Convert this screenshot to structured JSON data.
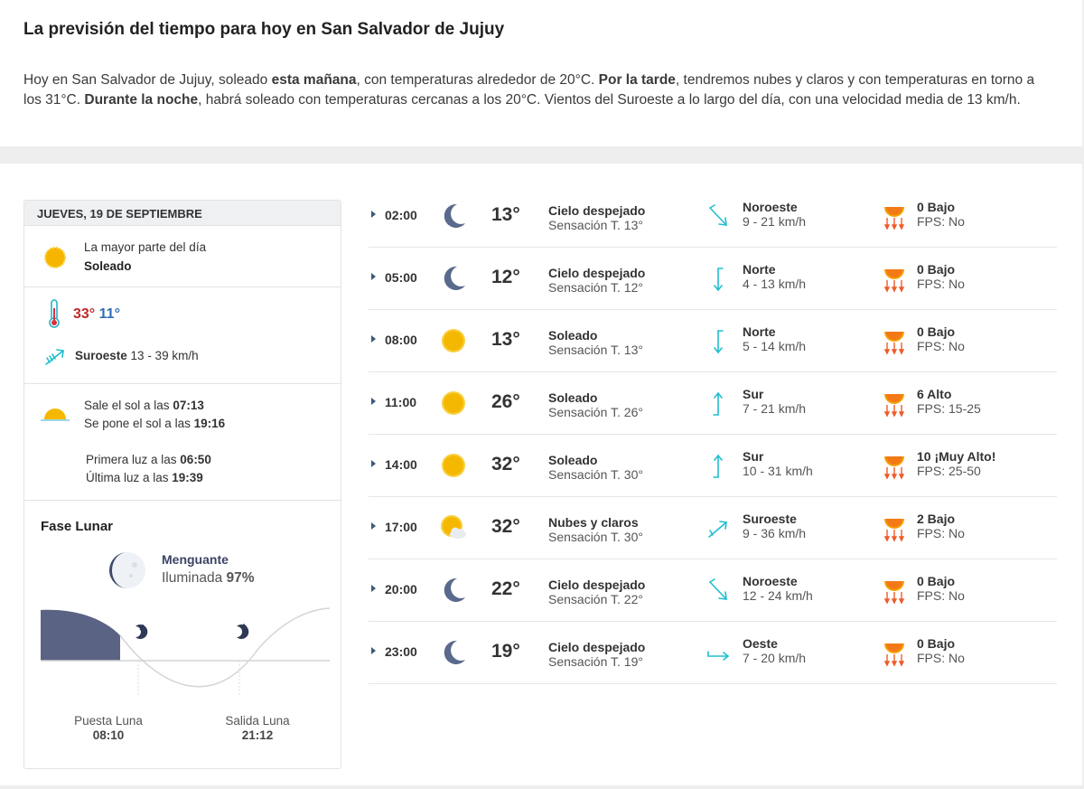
{
  "intro": {
    "title": "La previsión del tiempo para hoy en San Salvador de Jujuy",
    "p1": "Hoy en San Salvador de Jujuy, soleado ",
    "b1": "esta mañana",
    "p2": ", con temperaturas alrededor de 20°C. ",
    "b2": "Por la tarde",
    "p3": ", tendremos nubes y claros y con temperaturas en torno a los 31°C. ",
    "b3": "Durante la noche",
    "p4": ", habrá soleado con temperaturas cercanas a los 20°C. Vientos del Suroeste a lo largo del día, con una velocidad media de 13 km/h."
  },
  "day": {
    "header": "JUEVES, 19 DE SEPTIEMBRE",
    "summary_label": "La mayor parte del día",
    "summary_value": "Soleado",
    "tmax": "33°",
    "tmin": "11°",
    "wind_dir": "Suroeste",
    "wind_speed": "13 - 39 km/h",
    "sunrise_label": "Sale el sol a las ",
    "sunrise": "07:13",
    "sunset_label": "Se pone el sol a las ",
    "sunset": "19:16",
    "firstlight_label": "Primera luz a las ",
    "firstlight": "06:50",
    "lastlight_label": "Última luz a las ",
    "lastlight": "19:39",
    "moon_title": "Fase Lunar",
    "moon_phase": "Menguante",
    "moon_illum_label": "Iluminada ",
    "moon_illum": "97%",
    "moonset_label": "Puesta Luna",
    "moonset": "08:10",
    "moonrise_label": "Salida Luna",
    "moonrise": "21:12"
  },
  "colors": {
    "max_temp": "#c0282b",
    "min_temp": "#2f6fb5",
    "wind_icon": "#1fbfcf",
    "sun": "#f5b800",
    "moon": "#5a6a8c",
    "moon_chart": "#5a6383"
  },
  "hours": [
    {
      "time": "02:00",
      "icon": "moon-icon",
      "temp": "13°",
      "desc": "Cielo despejado",
      "feel": "Sensación T. 13°",
      "wind_dir": "Noroeste",
      "wind_speed": "9 - 21 km/h",
      "uv": "0 Bajo",
      "fps": "FPS: No"
    },
    {
      "time": "05:00",
      "icon": "moon-icon",
      "temp": "12°",
      "desc": "Cielo despejado",
      "feel": "Sensación T. 12°",
      "wind_dir": "Norte",
      "wind_speed": "4 - 13 km/h",
      "uv": "0 Bajo",
      "fps": "FPS: No"
    },
    {
      "time": "08:00",
      "icon": "sun-icon",
      "temp": "13°",
      "desc": "Soleado",
      "feel": "Sensación T. 13°",
      "wind_dir": "Norte",
      "wind_speed": "5 - 14 km/h",
      "uv": "0 Bajo",
      "fps": "FPS: No"
    },
    {
      "time": "11:00",
      "icon": "sun-icon",
      "temp": "26°",
      "desc": "Soleado",
      "feel": "Sensación T. 26°",
      "wind_dir": "Sur",
      "wind_speed": "7 - 21 km/h",
      "uv": "6 Alto",
      "fps": "FPS: 15-25"
    },
    {
      "time": "14:00",
      "icon": "sun-icon",
      "temp": "32°",
      "desc": "Soleado",
      "feel": "Sensación T. 30°",
      "wind_dir": "Sur",
      "wind_speed": "10 - 31 km/h",
      "uv": "10 ¡Muy Alto!",
      "fps": "FPS: 25-50"
    },
    {
      "time": "17:00",
      "icon": "partly-cloudy-icon",
      "temp": "32°",
      "desc": "Nubes y claros",
      "feel": "Sensación T. 30°",
      "wind_dir": "Suroeste",
      "wind_speed": "9 - 36 km/h",
      "uv": "2 Bajo",
      "fps": "FPS: No"
    },
    {
      "time": "20:00",
      "icon": "moon-icon",
      "temp": "22°",
      "desc": "Cielo despejado",
      "feel": "Sensación T. 22°",
      "wind_dir": "Noroeste",
      "wind_speed": "12 - 24 km/h",
      "uv": "0 Bajo",
      "fps": "FPS: No"
    },
    {
      "time": "23:00",
      "icon": "moon-icon",
      "temp": "19°",
      "desc": "Cielo despejado",
      "feel": "Sensación T. 19°",
      "wind_dir": "Oeste",
      "wind_speed": "7 - 20 km/h",
      "uv": "0 Bajo",
      "fps": "FPS: No"
    }
  ]
}
